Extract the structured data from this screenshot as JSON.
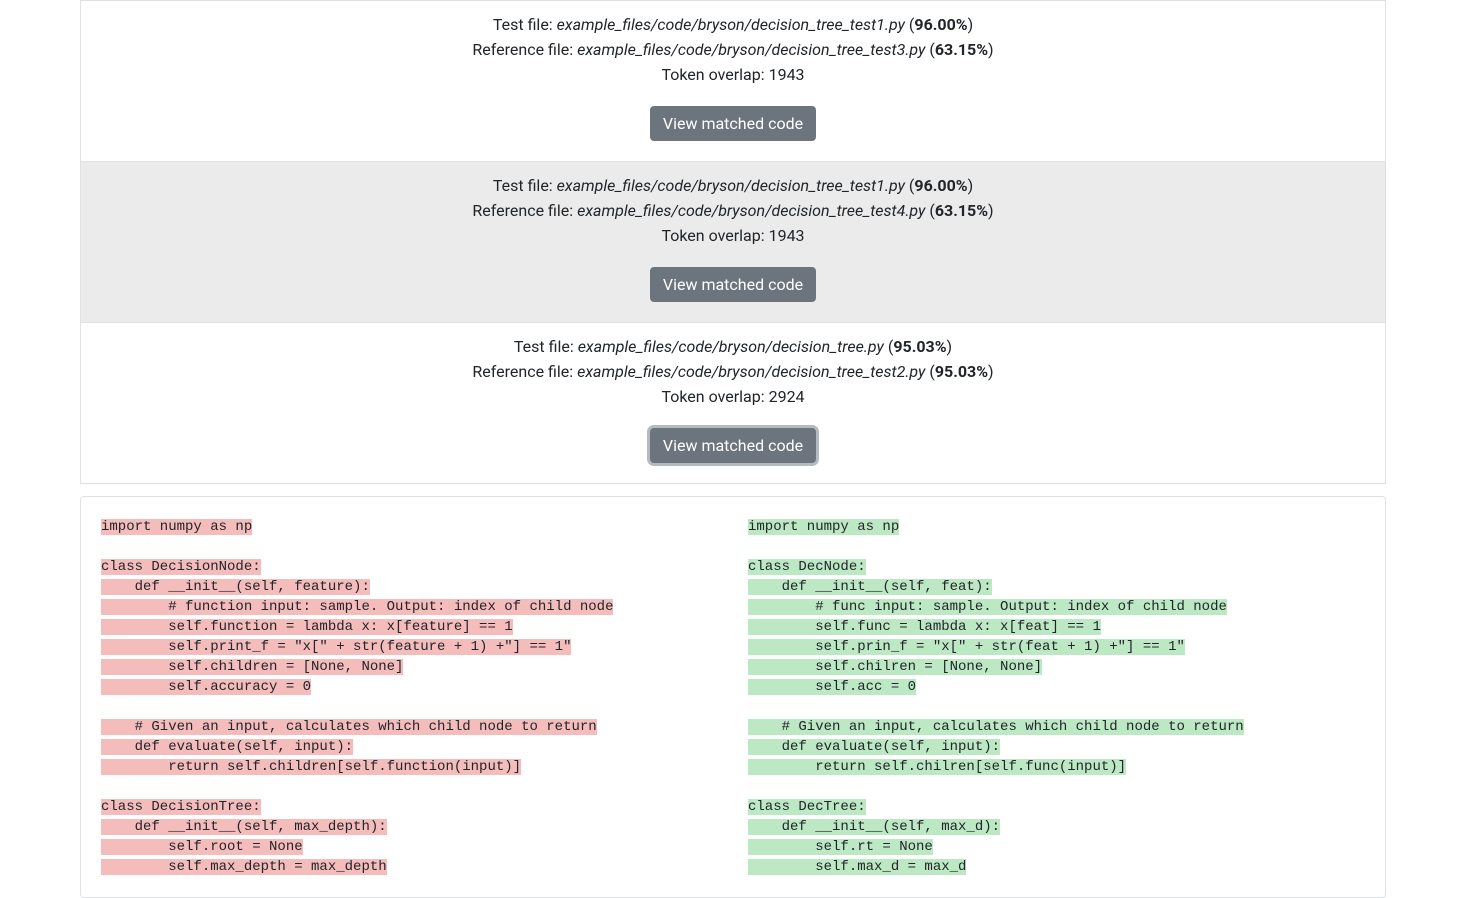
{
  "labels": {
    "test_file_prefix": "Test file: ",
    "reference_file_prefix": "Reference file: ",
    "token_overlap_prefix": "Token overlap: ",
    "view_button": "View matched code"
  },
  "results": [
    {
      "test_file": "example_files/code/bryson/decision_tree_test1.py",
      "test_pct": "96.00%",
      "reference_file": "example_files/code/bryson/decision_tree_test3.py",
      "reference_pct": "63.15%",
      "token_overlap": "1943"
    },
    {
      "test_file": "example_files/code/bryson/decision_tree_test1.py",
      "test_pct": "96.00%",
      "reference_file": "example_files/code/bryson/decision_tree_test4.py",
      "reference_pct": "63.15%",
      "token_overlap": "1943"
    },
    {
      "test_file": "example_files/code/bryson/decision_tree.py",
      "test_pct": "95.03%",
      "reference_file": "example_files/code/bryson/decision_tree_test2.py",
      "reference_pct": "95.03%",
      "token_overlap": "2924"
    }
  ],
  "code_left": [
    "import numpy as np",
    "",
    "class DecisionNode:",
    "    def __init__(self, feature):",
    "        # function input: sample. Output: index of child node",
    "        self.function = lambda x: x[feature] == 1",
    "        self.print_f = \"x[\" + str(feature + 1) +\"] == 1\"",
    "        self.children = [None, None]",
    "        self.accuracy = 0",
    "",
    "    # Given an input, calculates which child node to return",
    "    def evaluate(self, input):",
    "        return self.children[self.function(input)]",
    "",
    "class DecisionTree:",
    "    def __init__(self, max_depth):",
    "        self.root = None",
    "        self.max_depth = max_depth"
  ],
  "code_right": [
    "import numpy as np",
    "",
    "class DecNode:",
    "    def __init__(self, feat):",
    "        # func input: sample. Output: index of child node",
    "        self.func = lambda x: x[feat] == 1",
    "        self.prin_f = \"x[\" + str(feat + 1) +\"] == 1\"",
    "        self.chilren = [None, None]",
    "        self.acc = 0",
    "",
    "    # Given an input, calculates which child node to return",
    "    def evaluate(self, input):",
    "        return self.chilren[self.func(input)]",
    "",
    "class DecTree:",
    "    def __init__(self, max_d):",
    "        self.rt = None",
    "        self.max_d = max_d"
  ]
}
